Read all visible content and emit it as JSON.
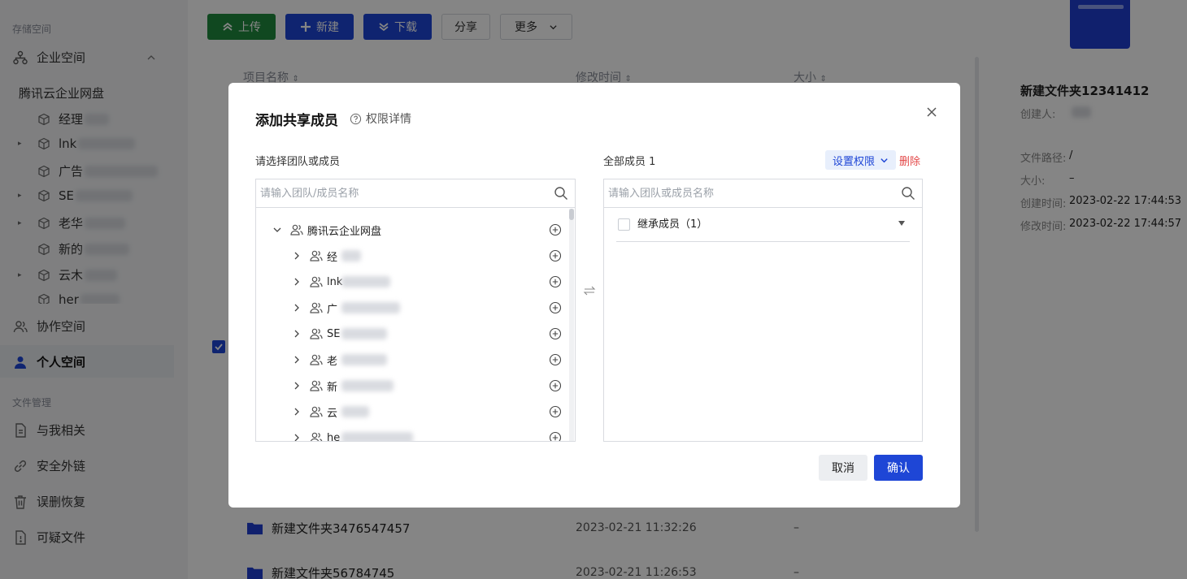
{
  "sidebar": {
    "storage_label": "存储空间",
    "enterprise_label": "企业空间",
    "tree_root": "腾讯云企业网盘",
    "tree_nodes": [
      {
        "prefix": "经理",
        "expandable": false
      },
      {
        "prefix": "lnk",
        "expandable": true
      },
      {
        "prefix": "广告",
        "expandable": false
      },
      {
        "prefix": "SE",
        "expandable": true
      },
      {
        "prefix": "老华",
        "expandable": true
      },
      {
        "prefix": "新的",
        "expandable": false
      },
      {
        "prefix": "云木",
        "expandable": true
      },
      {
        "prefix": "her",
        "expandable": false
      }
    ],
    "collab_label": "协作空间",
    "personal_label": "个人空间",
    "file_mgmt_label": "文件管理",
    "related_label": "与我相关",
    "link_label": "安全外链",
    "recover_label": "误删恢复",
    "suspicious_label": "可疑文件"
  },
  "toolbar": {
    "upload": "上传",
    "new": "新建",
    "download": "下载",
    "share": "分享",
    "more": "更多"
  },
  "table": {
    "col_name": "项目名称",
    "col_modified": "修改时间",
    "col_size": "大小",
    "rows": [
      {
        "name": "新建文件夹3476547457",
        "modified": "2023-02-21 11:32:26",
        "size": "–"
      },
      {
        "name": "新建文件夹56784745",
        "modified": "2023-02-21 11:26:53",
        "size": "–"
      }
    ]
  },
  "detail": {
    "title": "新建文件夹12341412",
    "creator_label": "创建人:",
    "path_label": "文件路径:",
    "path_value": "/",
    "size_label": "大小:",
    "size_value": "–",
    "created_label": "创建时间:",
    "created_value": "2023-02-22 17:44:53",
    "modified_label": "修改时间:",
    "modified_value": "2023-02-22 17:44:57"
  },
  "dialog": {
    "title": "添加共享成员",
    "help": "权限详情",
    "left_label": "请选择团队或成员",
    "right_label": "全部成员 1",
    "left_placeholder": "请输入团队/成员名称",
    "right_placeholder": "请输入团队或成员名称",
    "root_node": "腾讯云企业网盘",
    "nodes": [
      "经",
      "lnk",
      "广",
      "SE",
      "老",
      "新",
      "云",
      "he"
    ],
    "set_permission": "设置权限",
    "delete": "删除",
    "inherited": "继承成员（1）",
    "cancel": "取消",
    "confirm": "确认"
  },
  "colors": {
    "primary": "#1e46d6",
    "upload_green": "#1f8a3e",
    "danger": "#e34848"
  }
}
